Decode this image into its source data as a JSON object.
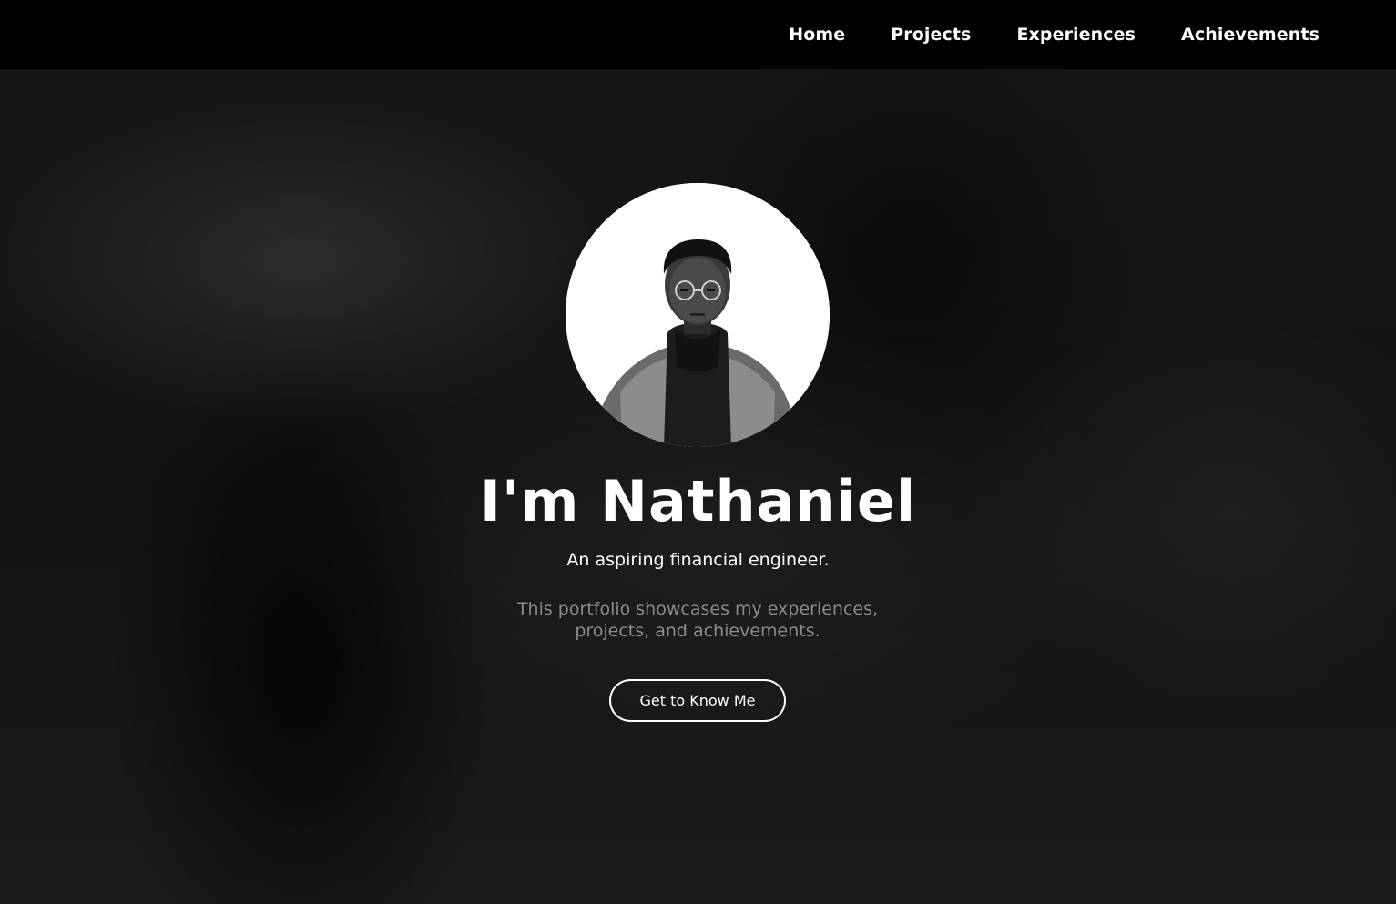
{
  "nav": {
    "items": [
      {
        "label": "Home"
      },
      {
        "label": "Projects"
      },
      {
        "label": "Experiences"
      },
      {
        "label": "Achievements"
      }
    ]
  },
  "hero": {
    "headline": "I'm Nathaniel",
    "tagline": "An aspiring financial engineer.",
    "description": "This portfolio showcases my experiences, projects, and achievements.",
    "cta_label": "Get to Know Me"
  },
  "colors": {
    "navbar_background": "#000000",
    "page_background": "#121212",
    "text_primary": "#ffffff",
    "text_muted": "#8a8a8a"
  }
}
